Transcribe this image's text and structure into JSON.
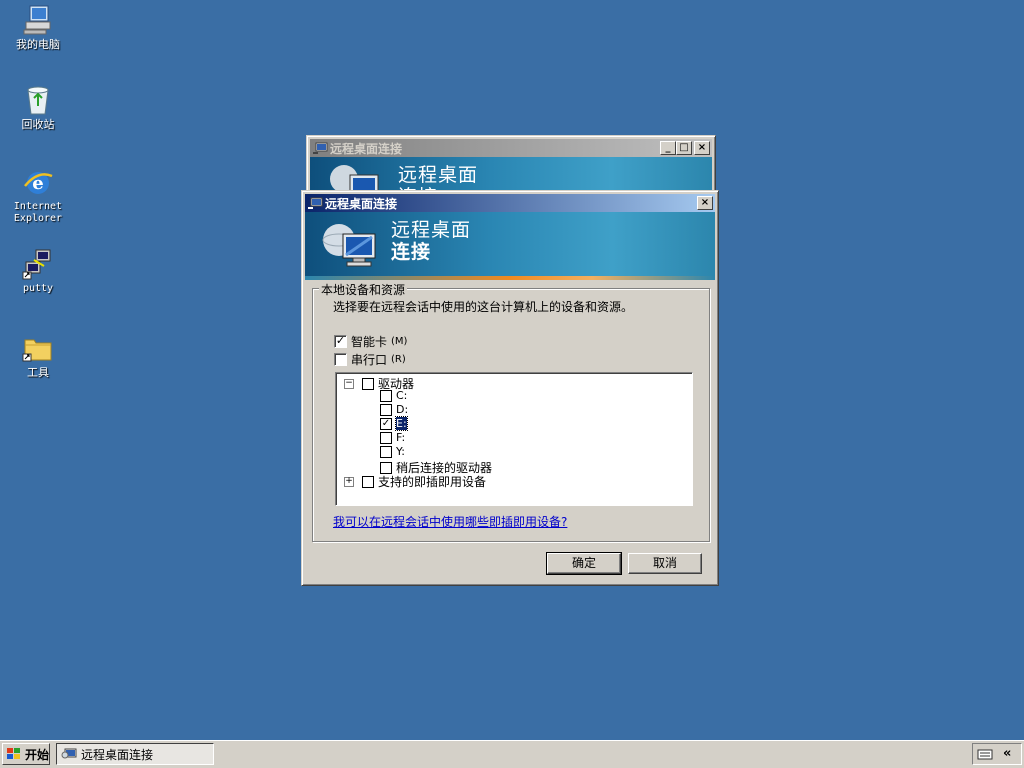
{
  "desktop": {
    "icons": [
      {
        "label": "我的电脑"
      },
      {
        "label": "回收站"
      },
      {
        "label": "Internet\nExplorer"
      },
      {
        "label": "putty"
      },
      {
        "label": "工具"
      }
    ]
  },
  "back_window": {
    "title": "远程桌面连接",
    "banner_line1": "远程桌面",
    "banner_line2": "连接"
  },
  "dialog": {
    "title": "远程桌面连接",
    "banner_line1": "远程桌面",
    "banner_line2": "连接",
    "group_label": "本地设备和资源",
    "description": "选择要在远程会话中使用的这台计算机上的设备和资源。",
    "smartcard": {
      "label": "智能卡",
      "accel": "(M)",
      "checked": true
    },
    "serial": {
      "label": "串行口",
      "accel": "(R)",
      "checked": false
    },
    "tree": {
      "drives_label": "驱动器",
      "drives": [
        {
          "label": "C:",
          "checked": false
        },
        {
          "label": "D:",
          "checked": false
        },
        {
          "label": "E:",
          "checked": true
        },
        {
          "label": "F:",
          "checked": false
        },
        {
          "label": "Y:",
          "checked": false
        },
        {
          "label": "稍后连接的驱动器",
          "checked": false
        }
      ],
      "pnp_label": "支持的即插即用设备"
    },
    "help_link": "我可以在远程会话中使用哪些即插即用设备?",
    "ok_label": "确定",
    "cancel_label": "取消"
  },
  "taskbar": {
    "start_label": "开始",
    "task_label": "远程桌面连接"
  }
}
